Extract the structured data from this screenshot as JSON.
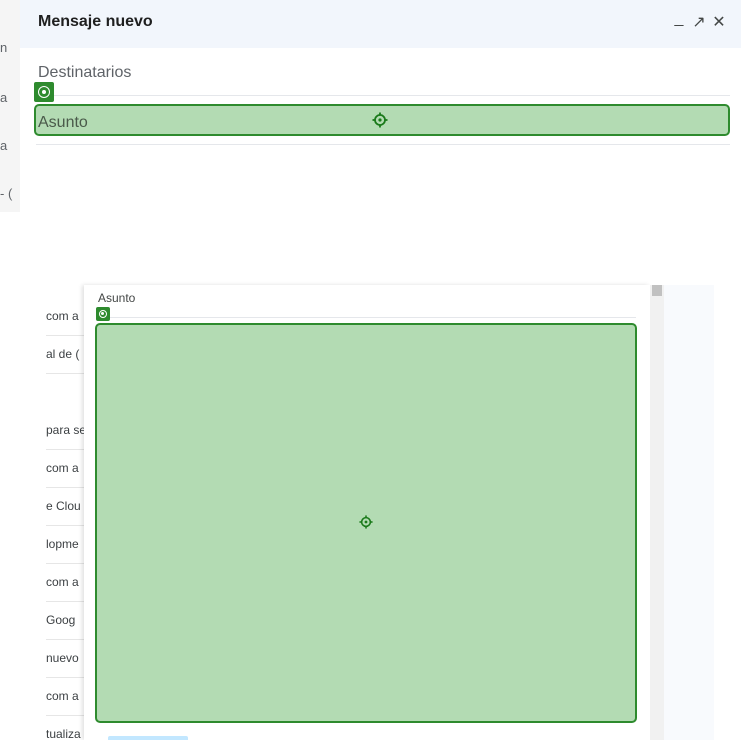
{
  "compose_window": {
    "title": "Mensaje nuevo",
    "minimize_label": "_",
    "expand_label": "↗",
    "close_label": "✕",
    "recipients_label": "Destinatarios",
    "subject_placeholder": "Asunto"
  },
  "compose_body": {
    "subject_label": "Asunto"
  },
  "left_fragments_top": [
    "n",
    "a",
    "a",
    "- ("
  ],
  "mail_list_fragments": [
    "com a",
    "al de (",
    "",
    "para se",
    "com a",
    "e Clou",
    "lopme",
    "com a",
    " Goog",
    "nuevo",
    "com a",
    "tualiza"
  ],
  "icons": {
    "highlight_tag": "target-circle-icon",
    "center_marker": "crosshair-icon"
  },
  "colors": {
    "highlight_fill": "#96cd96",
    "highlight_border": "#2e8b2e",
    "header_bg": "#f2f6fc"
  }
}
